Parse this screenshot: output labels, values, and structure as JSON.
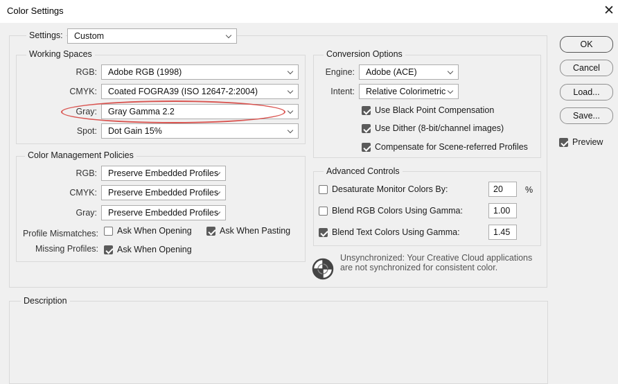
{
  "window": {
    "title": "Color Settings",
    "close_glyph": "✕"
  },
  "settings": {
    "label": "Settings:",
    "value": "Custom"
  },
  "working_spaces": {
    "legend": "Working Spaces",
    "rgb": {
      "label": "RGB:",
      "value": "Adobe RGB (1998)"
    },
    "cmyk": {
      "label": "CMYK:",
      "value": "Coated FOGRA39 (ISO 12647-2:2004)"
    },
    "gray": {
      "label": "Gray:",
      "value": "Gray Gamma 2.2"
    },
    "spot": {
      "label": "Spot:",
      "value": "Dot Gain 15%"
    }
  },
  "policies": {
    "legend": "Color Management Policies",
    "rgb": {
      "label": "RGB:",
      "value": "Preserve Embedded Profiles"
    },
    "cmyk": {
      "label": "CMYK:",
      "value": "Preserve Embedded Profiles"
    },
    "gray": {
      "label": "Gray:",
      "value": "Preserve Embedded Profiles"
    },
    "mismatches": {
      "label": "Profile Mismatches:",
      "ask_opening": {
        "label": "Ask When Opening",
        "checked": false
      },
      "ask_pasting": {
        "label": "Ask When Pasting",
        "checked": true
      }
    },
    "missing": {
      "label": "Missing Profiles:",
      "ask_opening": {
        "label": "Ask When Opening",
        "checked": true
      }
    }
  },
  "conversion": {
    "legend": "Conversion Options",
    "engine": {
      "label": "Engine:",
      "value": "Adobe (ACE)"
    },
    "intent": {
      "label": "Intent:",
      "value": "Relative Colorimetric"
    },
    "black_point": {
      "label": "Use Black Point Compensation",
      "checked": true
    },
    "dither": {
      "label": "Use Dither (8-bit/channel images)",
      "checked": true
    },
    "scene_referred": {
      "label": "Compensate for Scene-referred Profiles",
      "checked": true
    }
  },
  "advanced": {
    "legend": "Advanced Controls",
    "desaturate": {
      "label": "Desaturate Monitor Colors By:",
      "value": "20",
      "unit": "%",
      "checked": false
    },
    "blend_rgb": {
      "label": "Blend RGB Colors Using Gamma:",
      "value": "1.00",
      "checked": false
    },
    "blend_text": {
      "label": "Blend Text Colors Using Gamma:",
      "value": "1.45",
      "checked": true
    }
  },
  "sync_message": {
    "line1": "Unsynchronized: Your Creative Cloud applications",
    "line2": "are not synchronized for consistent color.",
    "icon": "unsynchronized-icon"
  },
  "description": {
    "legend": "Description"
  },
  "buttons": {
    "ok": "OK",
    "cancel": "Cancel",
    "load": "Load...",
    "save": "Save..."
  },
  "preview": {
    "label": "Preview",
    "checked": true
  },
  "colors": {
    "highlight_ellipse": "#d9534f",
    "checkbox_fill": "#5a5a5a"
  }
}
